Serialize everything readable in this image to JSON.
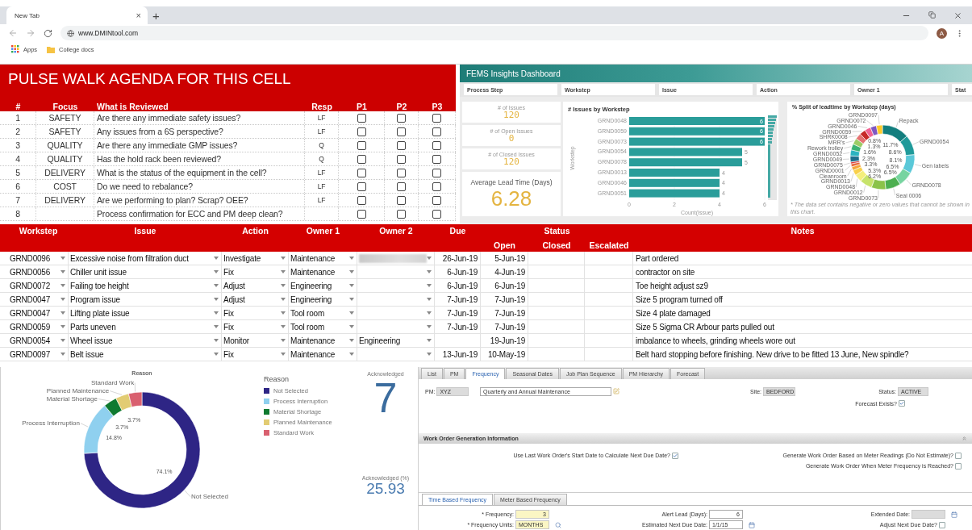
{
  "browser": {
    "tab_title": "New Tab",
    "tab_close": "×",
    "new_tab": "+",
    "url": "www.DMINtool.com",
    "profile_initial": "A",
    "bookmarks": [
      {
        "label": "Apps",
        "kind": "apps"
      },
      {
        "label": "College docs",
        "kind": "folder"
      }
    ]
  },
  "agenda": {
    "title": "PULSE WALK AGENDA FOR THIS CELL",
    "columns": [
      "#",
      "Focus",
      "What is Reviewed",
      "Resp",
      "P1",
      "P2",
      "P3"
    ],
    "rows": [
      {
        "number": "1",
        "focus": "SAFETY",
        "question": "Are there any immediate safety issues?",
        "resp": "LF",
        "p1": false,
        "p2": false,
        "p3": false
      },
      {
        "number": "2",
        "focus": "SAFETY",
        "question": "Any issues from a 6S perspective?",
        "resp": "LF",
        "p1": false,
        "p2": false,
        "p3": false
      },
      {
        "number": "3",
        "focus": "QUALITY",
        "question": "Are there any immediate GMP issues?",
        "resp": "Q",
        "p1": false,
        "p2": false,
        "p3": false
      },
      {
        "number": "4",
        "focus": "QUALITY",
        "question": "Has the hold rack been reviewed?",
        "resp": "Q",
        "p1": false,
        "p2": false,
        "p3": false
      },
      {
        "number": "5",
        "focus": "DELIVERY",
        "question": "What is the status of the equipment in the cell?",
        "resp": "LF",
        "p1": false,
        "p2": false,
        "p3": false
      },
      {
        "number": "6",
        "focus": "COST",
        "question": "Do we need to rebalance?",
        "resp": "LF",
        "p1": false,
        "p2": false,
        "p3": false
      },
      {
        "number": "7",
        "focus": "DELIVERY",
        "question": "Are we performing to plan? Scrap? OEE?",
        "resp": "LF",
        "p1": false,
        "p2": false,
        "p3": false
      },
      {
        "number": "8",
        "question": "Process confirmation for ECC and PM deep clean?",
        "p1": false,
        "p2": false,
        "p3": false
      }
    ]
  },
  "dashboard": {
    "title": "FEMS Insights Dashboard",
    "filters": [
      "Process Step",
      "Workstep",
      "Issue",
      "Action",
      "Owner 1",
      "Stat"
    ],
    "kpis": [
      {
        "label": "# of Issues",
        "value": "120",
        "kind": "small"
      },
      {
        "label": "# of Open Issues",
        "value": "0",
        "kind": "small"
      },
      {
        "label": "# of Closed Issues",
        "value": "120",
        "kind": "small"
      },
      {
        "label": "Average Lead Time (Days)",
        "value": "6.28",
        "kind": "large"
      }
    ],
    "bar_chart": {
      "chart_data": {
        "type": "bar",
        "orientation": "horizontal",
        "title": "# Issues by Workstep",
        "xlabel": "Count(Issue)",
        "ylabel": "Workstep",
        "categories": [
          "GRND0048",
          "GRND0059",
          "GRND0073",
          "GRND0054",
          "GRND0078",
          "GRND0013",
          "GRND0046",
          "GRND0051"
        ],
        "series": [
          {
            "color": "#2a9d9a",
            "values": [
              6,
              6,
              6,
              5,
              5,
              4,
              4,
              4
            ]
          }
        ],
        "xlim": [
          0,
          6
        ],
        "xticks": [
          0,
          2,
          4,
          6
        ],
        "data_labels": true
      }
    },
    "donut_chart": {
      "footnote": "* The data set contains negative or zero values that cannot be shown in this chart.",
      "chart_data": {
        "type": "donut",
        "title": "% Split of leadtime by Workstep (days)",
        "categories": [
          "Repack",
          "GRND0054",
          "Gen labels",
          "GRND0078",
          "Seal 0006",
          "GRND0073",
          "GRND0012",
          "GRND0048",
          "GRND0013",
          "Cleanroom",
          "GRND0001",
          "GRND0075",
          "GRND0049",
          "GRND0052",
          "Rework trolley",
          "MRR's",
          "SHRK0008",
          "GRND0059",
          "GRND0046",
          "GRND0072",
          "GRND0097"
        ],
        "series": [
          {
            "values": [
              11.7,
              8.6,
              8.1,
              6.5,
              6.5,
              6.2,
              5.3,
              3.3,
              2.3,
              1.6,
              1.3,
              0.8,
              2.6,
              2.6,
              2.6,
              2.6,
              2.6,
              2.6,
              2.6,
              2.6,
              2.6
            ]
          }
        ],
        "value_labels": [
          "11.7%",
          "8.6%",
          "8.1%",
          "6.5%",
          "6.5%",
          "6.2%",
          "5.3%",
          "3.3%",
          "2.3%",
          "1.6%",
          "1.3%",
          "0.8%",
          null,
          null,
          null,
          null,
          null,
          null,
          null,
          null,
          null
        ]
      }
    }
  },
  "issues_table": {
    "header": [
      "Workstep",
      "Issue",
      "Action",
      "Owner 1",
      "Owner 2",
      "Due",
      "Status",
      "Notes"
    ],
    "status_subheader": [
      "Open",
      "Closed",
      "Escalated"
    ],
    "rows": [
      {
        "workstep": "GRND0096",
        "issue": "Excessive noise from filtration duct",
        "action": "Investigate",
        "owner_1": "Maintenance",
        "owner_2_blurred": true,
        "due": "26-Jun-19",
        "open": "5-Jun-19",
        "notes": "Part ordered"
      },
      {
        "workstep": "GRND0056",
        "issue": "Chiller unit issue",
        "action": "Fix",
        "owner_1": "Maintenance",
        "owner_2_blurred": false,
        "due": "6-Jun-19",
        "open": "4-Jun-19",
        "notes": "contractor on site"
      },
      {
        "workstep": "GRND0072",
        "issue": "Failing toe height",
        "action": "Adjust",
        "owner_1": "Engineering",
        "owner_2_blurred": false,
        "due": "6-Jun-19",
        "open": "6-Jun-19",
        "notes": "Toe height adjust sz9"
      },
      {
        "workstep": "GRND0047",
        "issue": "Program issue",
        "action": "Adjust",
        "owner_1": "Engineering",
        "owner_2_blurred": false,
        "due": "7-Jun-19",
        "open": "7-Jun-19",
        "notes": "Size 5 program turned off"
      },
      {
        "workstep": "GRND0047",
        "issue": "Lifting plate issue",
        "action": "Fix",
        "owner_1": "Tool room",
        "owner_2_blurred": false,
        "due": "7-Jun-19",
        "open": "7-Jun-19",
        "notes": "Size 4 plate damaged"
      },
      {
        "workstep": "GRND0059",
        "issue": "Parts uneven",
        "action": "Fix",
        "owner_1": "Tool room",
        "owner_2_blurred": false,
        "due": "7-Jun-19",
        "open": "7-Jun-19",
        "notes": "Size 5 Sigma CR Arbour parts pulled out"
      },
      {
        "workstep": "GRND0054",
        "issue": "Wheel issue",
        "action": "Monitor",
        "owner_1": "Maintenance",
        "owner_2": "Engineering",
        "owner_2_blurred": false,
        "open": "19-Jun-19",
        "notes": "imbalance to wheels, grinding wheels wore out"
      },
      {
        "workstep": "GRND0097",
        "issue": "Belt issue",
        "action": "Fix",
        "owner_1": "Maintenance",
        "owner_2_blurred": false,
        "due": "13-Jun-19",
        "open": "10-May-19",
        "notes": "Belt hard stopping before finishing. New drive to be fitted 13 June, New spindle?"
      }
    ]
  },
  "reason_panel": {
    "chart_data": {
      "type": "donut",
      "title": "Reason",
      "categories": [
        "Not Selected",
        "Process Interruption",
        "Material Shortage",
        "Planned Maintenance",
        "Standard Work"
      ],
      "series": [
        {
          "values": [
            74.1,
            14.8,
            3.7,
            3.7,
            3.7
          ]
        }
      ],
      "value_labels": [
        "74.1%",
        "14.8%",
        null,
        "3.7%",
        "3.7%"
      ]
    },
    "legend": {
      "title": "Reason",
      "items": [
        {
          "label": "Not Selected",
          "color": "#2e2585"
        },
        {
          "label": "Process Interruption",
          "color": "#8fd0ef"
        },
        {
          "label": "Material Shortage",
          "color": "#0f7a30"
        },
        {
          "label": "Planned Maintenance",
          "color": "#e2cc73"
        },
        {
          "label": "Standard Work",
          "color": "#d9606f"
        }
      ]
    },
    "kpis": [
      {
        "label": "Acknowledged",
        "value": "7",
        "kind": "large"
      },
      {
        "label": "Acknowledged (%)",
        "value": "25.93",
        "kind": "small"
      }
    ]
  },
  "work_order_form": {
    "tabs": [
      {
        "label": "List",
        "selected": false
      },
      {
        "label": "PM",
        "selected": false
      },
      {
        "label": "Frequency",
        "selected": true
      },
      {
        "label": "Seasonal Dates",
        "selected": false
      },
      {
        "label": "Job Plan Sequence",
        "selected": false
      },
      {
        "label": "PM Hierarchy",
        "selected": false
      },
      {
        "label": "Forecast",
        "selected": false
      }
    ],
    "pm_label": "PM:",
    "pm_value": "XYZ",
    "description": "Quarterly and Annual Maintenance",
    "site_label": "Site:",
    "site_value": "BEDFORD",
    "status_label": "Status:",
    "status_value": "ACTIVE",
    "forecast": {
      "label": "Forecast Exists?",
      "checked": true
    },
    "section_title": "Work Order Generation Information",
    "options": [
      {
        "label": "Use Last Work Order's Start Date to Calculate Next Due Date?",
        "checked": true
      },
      {
        "label": "Generate Work Order Based on Meter Readings (Do Not Estimate)?",
        "checked": false
      },
      {
        "label": "Generate Work Order When Meter Frequency is Reached?",
        "checked": false
      }
    ],
    "subtabs": [
      {
        "label": "Time Based Frequency",
        "selected": true
      },
      {
        "label": "Meter Based Frequency",
        "selected": false
      }
    ],
    "fields": [
      {
        "label": "* Frequency:",
        "value": "3",
        "kind": "required"
      },
      {
        "label": "Alert Lead (Days):",
        "value": "6",
        "kind": "number"
      },
      {
        "label": "Extended Date:",
        "kind": "readonly-date"
      },
      {
        "label": "* Frequency Units:",
        "value": "MONTHS",
        "kind": "lookup"
      },
      {
        "label": "Estimated Next Due Date:",
        "value": "1/1/15",
        "kind": "date"
      },
      {
        "label": "Adjust Next Due Date?",
        "kind": "checkbox",
        "checked": false
      }
    ]
  }
}
